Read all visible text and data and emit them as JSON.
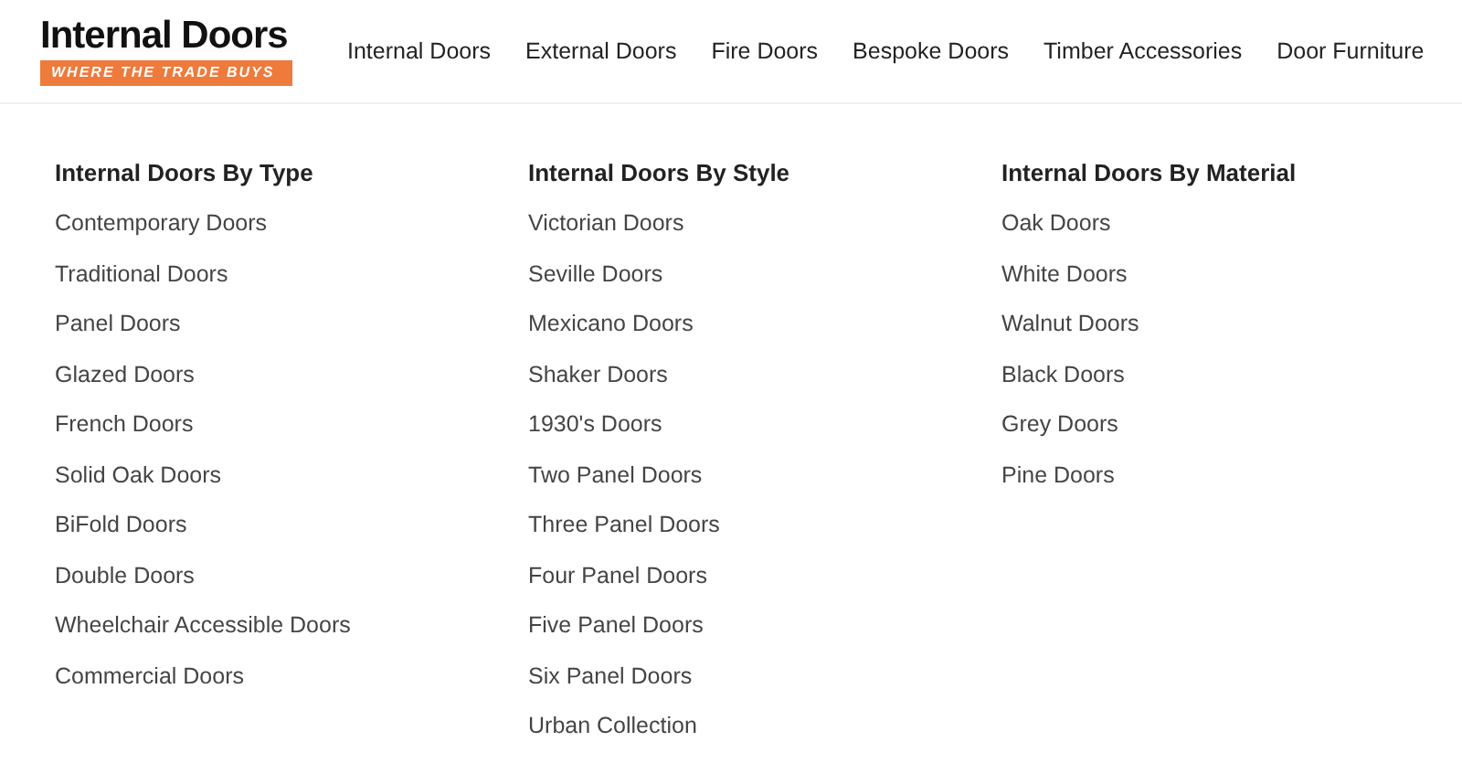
{
  "logo": {
    "title": "Internal Doors",
    "tagline": "WHERE THE TRADE BUYS"
  },
  "nav": [
    "Internal Doors",
    "External Doors",
    "Fire Doors",
    "Bespoke Doors",
    "Timber Accessories",
    "Door Furniture"
  ],
  "menu_columns": [
    {
      "heading": "Internal Doors By Type",
      "links": [
        "Contemporary Doors",
        "Traditional Doors",
        "Panel Doors",
        "Glazed Doors",
        "French Doors",
        "Solid Oak Doors",
        "BiFold Doors",
        "Double Doors",
        "Wheelchair Accessible Doors",
        "Commercial Doors"
      ]
    },
    {
      "heading": "Internal Doors By Style",
      "links": [
        "Victorian Doors",
        "Seville Doors",
        "Mexicano Doors",
        "Shaker Doors",
        "1930's Doors",
        "Two Panel Doors",
        "Three Panel Doors",
        "Four Panel Doors",
        "Five Panel Doors",
        "Six Panel Doors",
        "Urban Collection"
      ]
    },
    {
      "heading": "Internal Doors By Material",
      "links": [
        "Oak Doors",
        "White Doors",
        "Walnut Doors",
        "Black Doors",
        "Grey Doors",
        "Pine Doors"
      ]
    }
  ]
}
